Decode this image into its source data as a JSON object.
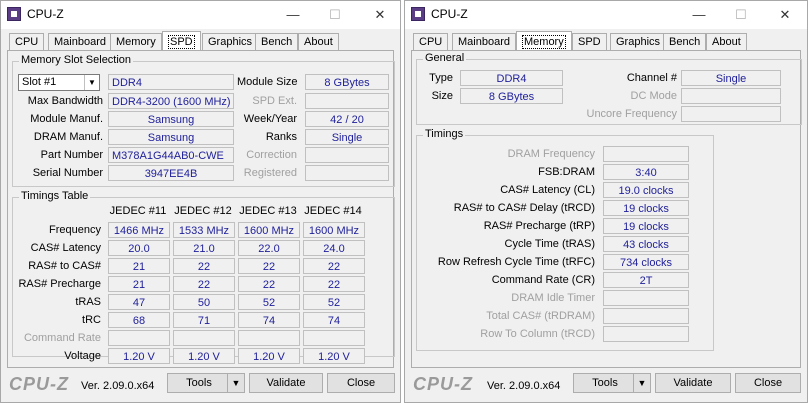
{
  "left_window": {
    "title": "CPU-Z",
    "tabs": [
      "CPU",
      "Mainboard",
      "Memory",
      "SPD",
      "Graphics",
      "Bench",
      "About"
    ],
    "active_tab": "SPD",
    "slot_group_title": "Memory Slot Selection",
    "slot_select": "Slot #1",
    "memory_type": "DDR4",
    "module_size_label": "Module Size",
    "module_size": "8 GBytes",
    "max_bandwidth_label": "Max Bandwidth",
    "max_bandwidth": "DDR4-3200 (1600 MHz)",
    "spd_ext_label": "SPD Ext.",
    "module_manuf_label": "Module Manuf.",
    "module_manuf": "Samsung",
    "week_year_label": "Week/Year",
    "week_year": "42 / 20",
    "dram_manuf_label": "DRAM Manuf.",
    "dram_manuf": "Samsung",
    "ranks_label": "Ranks",
    "ranks": "Single",
    "part_number_label": "Part Number",
    "part_number": "M378A1G44AB0-CWE",
    "correction_label": "Correction",
    "serial_number_label": "Serial Number",
    "serial_number": "3947EE4B",
    "registered_label": "Registered",
    "timings_group_title": "Timings Table",
    "jedec_headers": [
      "JEDEC #11",
      "JEDEC #12",
      "JEDEC #13",
      "JEDEC #14"
    ],
    "timing_rows": [
      {
        "label": "Frequency",
        "values": [
          "1466 MHz",
          "1533 MHz",
          "1600 MHz",
          "1600 MHz"
        ],
        "dim": false
      },
      {
        "label": "CAS# Latency",
        "values": [
          "20.0",
          "21.0",
          "22.0",
          "24.0"
        ],
        "dim": false
      },
      {
        "label": "RAS# to CAS#",
        "values": [
          "21",
          "22",
          "22",
          "22"
        ],
        "dim": false
      },
      {
        "label": "RAS# Precharge",
        "values": [
          "21",
          "22",
          "22",
          "22"
        ],
        "dim": false
      },
      {
        "label": "tRAS",
        "values": [
          "47",
          "50",
          "52",
          "52"
        ],
        "dim": false
      },
      {
        "label": "tRC",
        "values": [
          "68",
          "71",
          "74",
          "74"
        ],
        "dim": false
      },
      {
        "label": "Command Rate",
        "values": [
          "",
          "",
          "",
          ""
        ],
        "dim": true
      },
      {
        "label": "Voltage",
        "values": [
          "1.20 V",
          "1.20 V",
          "1.20 V",
          "1.20 V"
        ],
        "dim": false
      }
    ],
    "logo": "CPU-Z",
    "version": "Ver. 2.09.0.x64",
    "tools_label": "Tools",
    "validate_label": "Validate",
    "close_label": "Close"
  },
  "right_window": {
    "title": "CPU-Z",
    "tabs": [
      "CPU",
      "Mainboard",
      "Memory",
      "SPD",
      "Graphics",
      "Bench",
      "About"
    ],
    "active_tab": "Memory",
    "general_group_title": "General",
    "type_label": "Type",
    "type": "DDR4",
    "channel_label": "Channel #",
    "channel": "Single",
    "size_label": "Size",
    "size": "8 GBytes",
    "dc_mode_label": "DC Mode",
    "uncore_label": "Uncore Frequency",
    "timings_group_title": "Timings",
    "timing_rows": [
      {
        "label": "DRAM Frequency",
        "value": "",
        "dim": true
      },
      {
        "label": "FSB:DRAM",
        "value": "3:40",
        "dim": false
      },
      {
        "label": "CAS# Latency (CL)",
        "value": "19.0 clocks",
        "dim": false
      },
      {
        "label": "RAS# to CAS# Delay (tRCD)",
        "value": "19 clocks",
        "dim": false
      },
      {
        "label": "RAS# Precharge (tRP)",
        "value": "19 clocks",
        "dim": false
      },
      {
        "label": "Cycle Time (tRAS)",
        "value": "43 clocks",
        "dim": false
      },
      {
        "label": "Row Refresh Cycle Time (tRFC)",
        "value": "734 clocks",
        "dim": false
      },
      {
        "label": "Command Rate (CR)",
        "value": "2T",
        "dim": false
      },
      {
        "label": "DRAM Idle Timer",
        "value": "",
        "dim": true
      },
      {
        "label": "Total CAS# (tRDRAM)",
        "value": "",
        "dim": true
      },
      {
        "label": "Row To Column (tRCD)",
        "value": "",
        "dim": true
      }
    ],
    "logo": "CPU-Z",
    "version": "Ver. 2.09.0.x64",
    "tools_label": "Tools",
    "validate_label": "Validate",
    "close_label": "Close"
  },
  "title_buttons": {
    "minimize": "—",
    "maximize": "☐",
    "close": "✕"
  }
}
